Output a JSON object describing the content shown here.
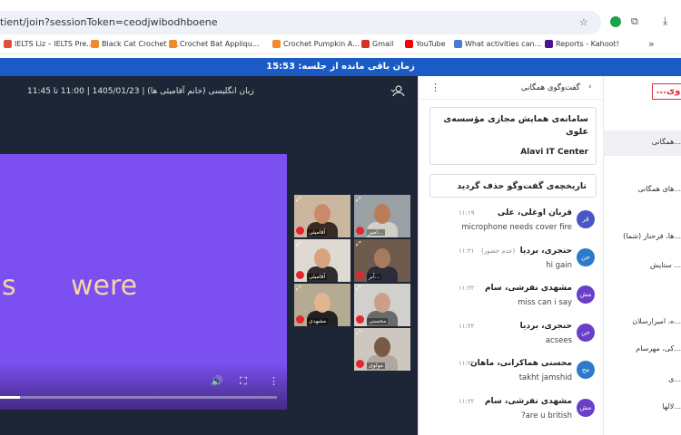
{
  "browser": {
    "url": "tient/join?sessionToken=ceodjwibodhboene",
    "bookmarks": [
      {
        "label": "IELTS Liz – IELTS Pre...",
        "color": "#e24d3c"
      },
      {
        "label": "Black Cat Crochet P...",
        "color": "#f08c2e"
      },
      {
        "label": "Crochet Bat Appliqu...",
        "color": "#f08c2e"
      },
      {
        "label": "Crochet Pumpkin A...",
        "color": "#f08c2e"
      },
      {
        "label": "Gmail",
        "color": "#d93025"
      },
      {
        "label": "YouTube",
        "color": "#ff0000"
      },
      {
        "label": "What activities can...",
        "color": "#4a7bd3"
      },
      {
        "label": "Reports - Kahoot!",
        "color": "#46178f"
      }
    ],
    "more": "»"
  },
  "timer": {
    "text": "زمان باقی مانده از جلسه: 15:53"
  },
  "session": {
    "info": "زبان انگلیسی (خانم آقامیئی ها) | 1405/01/23 | 11:00 تا 11:45"
  },
  "slide": {
    "word_left": "s",
    "word_right": "were"
  },
  "tiles": [
    {
      "name": "آقامیئی",
      "skin": "#c98b6a",
      "cloth": "#3a2a22",
      "bg": "#cbb7a0"
    },
    {
      "name": "امیر...",
      "skin": "#b97d5a",
      "cloth": "#d2cfc8",
      "bg": "#9aa1a4"
    },
    {
      "name": "آقامیئی",
      "skin": "#d9a27f",
      "cloth": "#2d2d2d",
      "bg": "#dedad2"
    },
    {
      "name": "آبر...",
      "skin": "#a87a5e",
      "cloth": "#2d2d3a",
      "bg": "#6f5a4e"
    },
    {
      "name": "محسنی",
      "skin": "#caa088",
      "cloth": "#6a6a6a",
      "bg": "#d1d0cc"
    },
    {
      "name": "مشهدی",
      "skin": "#e2b490",
      "cloth": "#222222",
      "bg": "#b5aa92"
    },
    {
      "name": "مولوی",
      "skin": "#7a5a45",
      "cloth": "#b0a7a0",
      "bg": "#cdc7bf"
    }
  ],
  "chat": {
    "title": "گفت‌وگوی همگانی",
    "org_name": "سامانه‌ی همایش مجازی مؤسسه‌ی علوی",
    "org_sub": "Alavi IT Center",
    "cleared": "تاریخچه‌ی گفت‌وگو حذف گردید",
    "messages": [
      {
        "name": "قربان اوغلی، علی",
        "time": "۱۱:۱۹",
        "text": "microphone needs cover fire",
        "avatar": "قر",
        "color": "#4c55c8"
      },
      {
        "name": "حنجری، بردیا",
        "time": "۱۱:۲۱",
        "status": "(عدم حضور)",
        "text": "hi gain",
        "avatar": "حن",
        "color": "#2c7ac9"
      },
      {
        "name": "مشهدی نفرشی، سام",
        "time": "۱۱:۲۲",
        "text": "miss can i say",
        "avatar": "مش",
        "color": "#6a3fc8"
      },
      {
        "name": "حنجری، بردیا",
        "time": "۱۱:۲۲",
        "text": "acsees",
        "avatar": "حن",
        "color": "#6a3fc8"
      },
      {
        "name": "محسنی هماکرانی، ماهان",
        "time": "۱۱:۲۲",
        "text": "takht jamshid",
        "avatar": "مح",
        "color": "#2c7ac9"
      },
      {
        "name": "مشهدی نفرشی، سام",
        "time": "۱۱:۲۲",
        "text": "are u british?",
        "avatar": "مش",
        "color": "#6a3fc8"
      }
    ]
  },
  "sidebar": {
    "logo": "...وی",
    "items": [
      "...همگانی",
      "...های همگانی",
      "...ها، فرحناز (شما)",
      "... ستایش",
      "...ه، امیرارسلان",
      "...کی، مهرسام",
      "...ی",
      "...لالها"
    ]
  }
}
